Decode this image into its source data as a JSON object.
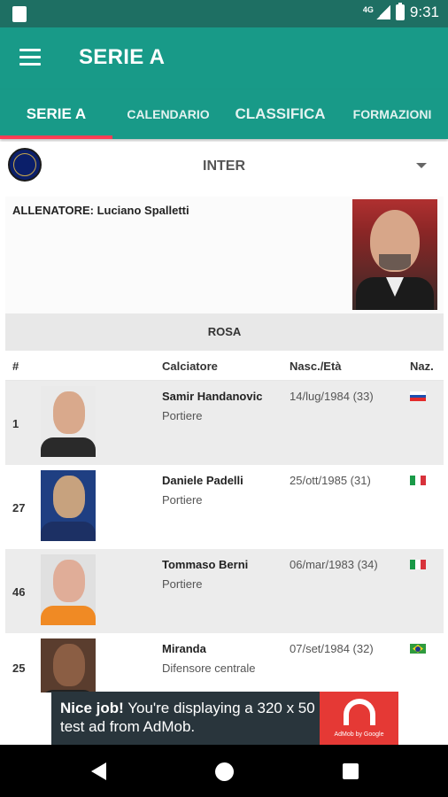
{
  "status_bar": {
    "network": "4G",
    "time": "9:31"
  },
  "app_bar": {
    "title": "SERIE A"
  },
  "tabs": [
    {
      "label": "SERIE A",
      "active": true
    },
    {
      "label": "CALENDARIO",
      "active": false
    },
    {
      "label": "CLASSIFICA",
      "active": false
    },
    {
      "label": "FORMAZIONI",
      "active": false
    }
  ],
  "team": {
    "name": "INTER"
  },
  "coach": {
    "label": "ALLENATORE: Luciano Spalletti"
  },
  "roster": {
    "title": "ROSA",
    "columns": {
      "number": "#",
      "player": "Calciatore",
      "birth": "Nasc./Età",
      "nationality": "Naz."
    },
    "players": [
      {
        "number": "1",
        "name": "Samir Handanovic",
        "role": "Portiere",
        "birth": "14/lug/1984 (33)",
        "flag": "slovenia-flag-icon"
      },
      {
        "number": "27",
        "name": "Daniele Padelli",
        "role": "Portiere",
        "birth": "25/ott/1985 (31)",
        "flag": "italy-flag-icon"
      },
      {
        "number": "46",
        "name": "Tommaso Berni",
        "role": "Portiere",
        "birth": "06/mar/1983 (34)",
        "flag": "italy-flag-icon"
      },
      {
        "number": "25",
        "name": "Miranda",
        "role": "Difensore centrale",
        "birth": "07/set/1984 (32)",
        "flag": "brazil-flag-icon"
      }
    ]
  },
  "ad": {
    "bold": "Nice job!",
    "text": " You're displaying a 320 x 50 test ad from AdMob.",
    "logo_text": "AdMob by Google"
  },
  "colors": {
    "primary": "#189a88",
    "status_bar": "#1e6f63",
    "tab_indicator": "#ff3d55",
    "ad_background": "#29353c",
    "ad_logo": "#e53935"
  }
}
